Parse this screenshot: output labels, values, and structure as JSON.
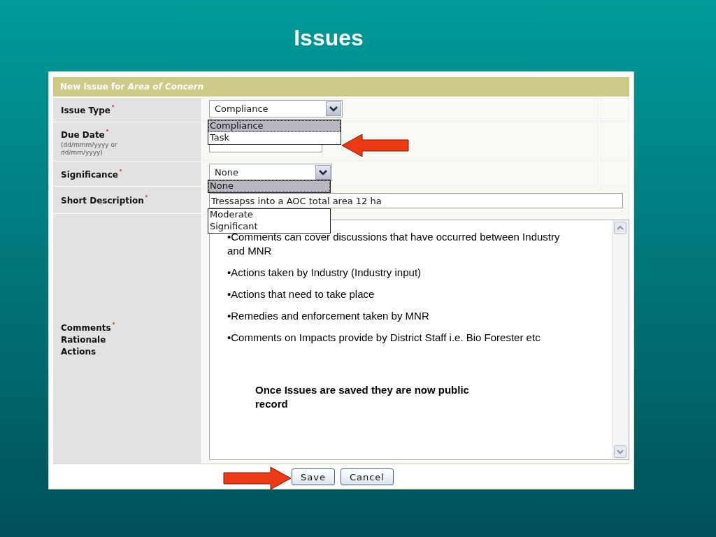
{
  "slide_title": "Issues",
  "form": {
    "title": "New Issue for *Area of Concern*",
    "fields": [
      {
        "kind": "select",
        "label": "Issue Type",
        "required": true,
        "value": "Compliance",
        "expanded": true,
        "options": [
          {
            "label": "Compliance",
            "selected": true,
            "gap_before": false
          },
          {
            "label": "Task",
            "selected": false,
            "gap_before": false
          }
        ]
      },
      {
        "kind": "date",
        "label": "Due Date",
        "required": true,
        "hint": "(dd/mmm/yyyy or dd/mm/yyyy)"
      },
      {
        "kind": "select",
        "label": "Significance",
        "required": true,
        "value": "None",
        "expanded": true,
        "options": [
          {
            "label": "None",
            "selected": true,
            "gap_before": false
          },
          {
            "label": "Moderate",
            "selected": false,
            "gap_before": true
          },
          {
            "label": "Significant",
            "selected": false,
            "gap_before": false
          }
        ]
      },
      {
        "kind": "text",
        "label": "Short Description",
        "required": true,
        "value": "Tressapss into a AOC total area 12 ha"
      },
      {
        "kind": "textarea",
        "label": "Comments",
        "required": true,
        "sublabels": [
          "Rationale",
          "Actions"
        ],
        "bullets": [
          "•Comments can cover discussions that have occurred between Industry and MNR",
          "•Actions taken by Industry (Industry input)",
          "•Actions that need to take place",
          "•Remedies and enforcement taken by MNR",
          "•Comments on Impacts provide by District Staff i.e. Bio Forester etc"
        ],
        "note": "Once Issues are saved they are now public record"
      }
    ],
    "buttons": [
      "Save",
      "Cancel"
    ]
  },
  "annotations": [
    {
      "kind": "arrow-left"
    },
    {
      "kind": "arrow-right"
    }
  ]
}
